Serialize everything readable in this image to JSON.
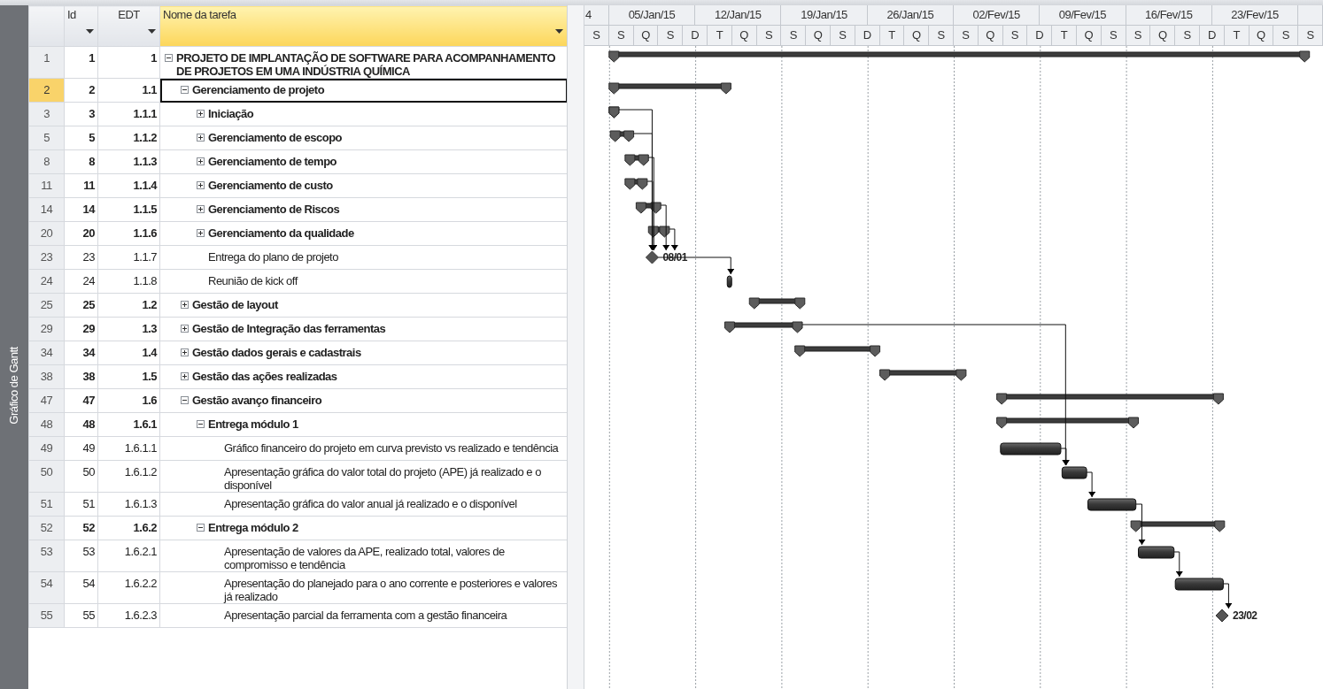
{
  "view_bar": {
    "label": "Gráfico de Gantt"
  },
  "table": {
    "columns": [
      {
        "label": "Id",
        "selected": false
      },
      {
        "label": "EDT",
        "selected": false
      },
      {
        "label": "Nome da tarefa",
        "selected": true
      }
    ],
    "rows": [
      {
        "row": "1",
        "id": "1",
        "edt": "1",
        "name": "PROJETO DE IMPLANTAÇÃO DE SOFTWARE PARA ACOMPANHAMENTO DE PROJETOS EM UMA INDÚSTRIA QUÍMICA",
        "kind": "summary",
        "expanded": true,
        "selected": false,
        "children": [
          {
            "row": "2",
            "id": "2",
            "edt": "1.1",
            "name": "Gerenciamento de projeto",
            "kind": "summary",
            "expanded": true,
            "selected": true,
            "children": [
              {
                "row": "3",
                "id": "3",
                "edt": "1.1.1",
                "name": "Iniciação",
                "kind": "summary",
                "expanded": false,
                "selected": false
              },
              {
                "row": "5",
                "id": "5",
                "edt": "1.1.2",
                "name": "Gerenciamento de escopo",
                "kind": "summary",
                "expanded": false,
                "selected": false
              },
              {
                "row": "8",
                "id": "8",
                "edt": "1.1.3",
                "name": "Gerenciamento de tempo",
                "kind": "summary",
                "expanded": false,
                "selected": false
              },
              {
                "row": "11",
                "id": "11",
                "edt": "1.1.4",
                "name": "Gerenciamento de custo",
                "kind": "summary",
                "expanded": false,
                "selected": false
              },
              {
                "row": "14",
                "id": "14",
                "edt": "1.1.5",
                "name": "Gerenciamento de Riscos",
                "kind": "summary",
                "expanded": false,
                "selected": false
              },
              {
                "row": "20",
                "id": "20",
                "edt": "1.1.6",
                "name": "Gerenciamento da qualidade",
                "kind": "summary",
                "expanded": false,
                "selected": false
              },
              {
                "row": "23",
                "id": "23",
                "edt": "1.1.7",
                "name": "Entrega do plano de projeto",
                "kind": "milestone",
                "bar_label": "08/01",
                "selected": false
              },
              {
                "row": "24",
                "id": "24",
                "edt": "1.1.8",
                "name": "Reunião de kick off",
                "kind": "task",
                "selected": false
              }
            ]
          },
          {
            "row": "25",
            "id": "25",
            "edt": "1.2",
            "name": "Gestão de layout",
            "kind": "summary",
            "expanded": false,
            "selected": false
          },
          {
            "row": "29",
            "id": "29",
            "edt": "1.3",
            "name": "Gestão de Integração das ferramentas",
            "kind": "summary",
            "expanded": false,
            "selected": false
          },
          {
            "row": "34",
            "id": "34",
            "edt": "1.4",
            "name": "Gestão dados gerais e cadastrais",
            "kind": "summary",
            "expanded": false,
            "selected": false
          },
          {
            "row": "38",
            "id": "38",
            "edt": "1.5",
            "name": "Gestão das ações realizadas",
            "kind": "summary",
            "expanded": false,
            "selected": false
          },
          {
            "row": "47",
            "id": "47",
            "edt": "1.6",
            "name": "Gestão avanço financeiro",
            "kind": "summary",
            "expanded": true,
            "selected": false,
            "children": [
              {
                "row": "48",
                "id": "48",
                "edt": "1.6.1",
                "name": "Entrega módulo 1",
                "kind": "summary",
                "expanded": true,
                "selected": false,
                "children": [
                  {
                    "row": "49",
                    "id": "49",
                    "edt": "1.6.1.1",
                    "name": "Gráfico financeiro do projeto em curva previsto vs realizado e tendência",
                    "kind": "task",
                    "selected": false
                  },
                  {
                    "row": "50",
                    "id": "50",
                    "edt": "1.6.1.2",
                    "name": "Apresentação gráfica do valor total do projeto (APE) já realizado e o disponível",
                    "kind": "task",
                    "selected": false
                  },
                  {
                    "row": "51",
                    "id": "51",
                    "edt": "1.6.1.3",
                    "name": "Apresentação gráfica do valor anual já realizado e o disponível",
                    "kind": "task",
                    "selected": false
                  }
                ]
              },
              {
                "row": "52",
                "id": "52",
                "edt": "1.6.2",
                "name": "Entrega módulo 2",
                "kind": "summary",
                "expanded": true,
                "selected": false,
                "children": [
                  {
                    "row": "53",
                    "id": "53",
                    "edt": "1.6.2.1",
                    "name": "Apresentação de valores da APE, realizado total, valores de compromisso e tendência",
                    "kind": "task",
                    "selected": false
                  },
                  {
                    "row": "54",
                    "id": "54",
                    "edt": "1.6.2.2",
                    "name": "Apresentação do planejado para o ano corrente e posteriores e valores já realizado",
                    "kind": "task",
                    "selected": false
                  },
                  {
                    "row": "55",
                    "id": "55",
                    "edt": "1.6.2.3",
                    "name": "Apresentação parcial da ferramenta com a gestão financeira",
                    "kind": "milestone",
                    "bar_label": "23/02",
                    "selected": false
                  }
                ]
              }
            ]
          }
        ]
      }
    ]
  },
  "timescale": {
    "partial_week_label": "4",
    "weeks": [
      "05/Jan/15",
      "12/Jan/15",
      "19/Jan/15",
      "26/Jan/15",
      "02/Fev/15",
      "09/Fev/15",
      "16/Fev/15",
      "23/Fev/15"
    ],
    "day_letters": [
      "S",
      "S",
      "Q",
      "S",
      "D",
      "T",
      "Q",
      "S",
      "S",
      "Q",
      "S",
      "D",
      "T",
      "Q",
      "S",
      "S",
      "Q",
      "S",
      "D",
      "T",
      "Q",
      "S",
      "S",
      "Q",
      "S",
      "D",
      "T",
      "Q",
      "S",
      "S"
    ]
  }
}
